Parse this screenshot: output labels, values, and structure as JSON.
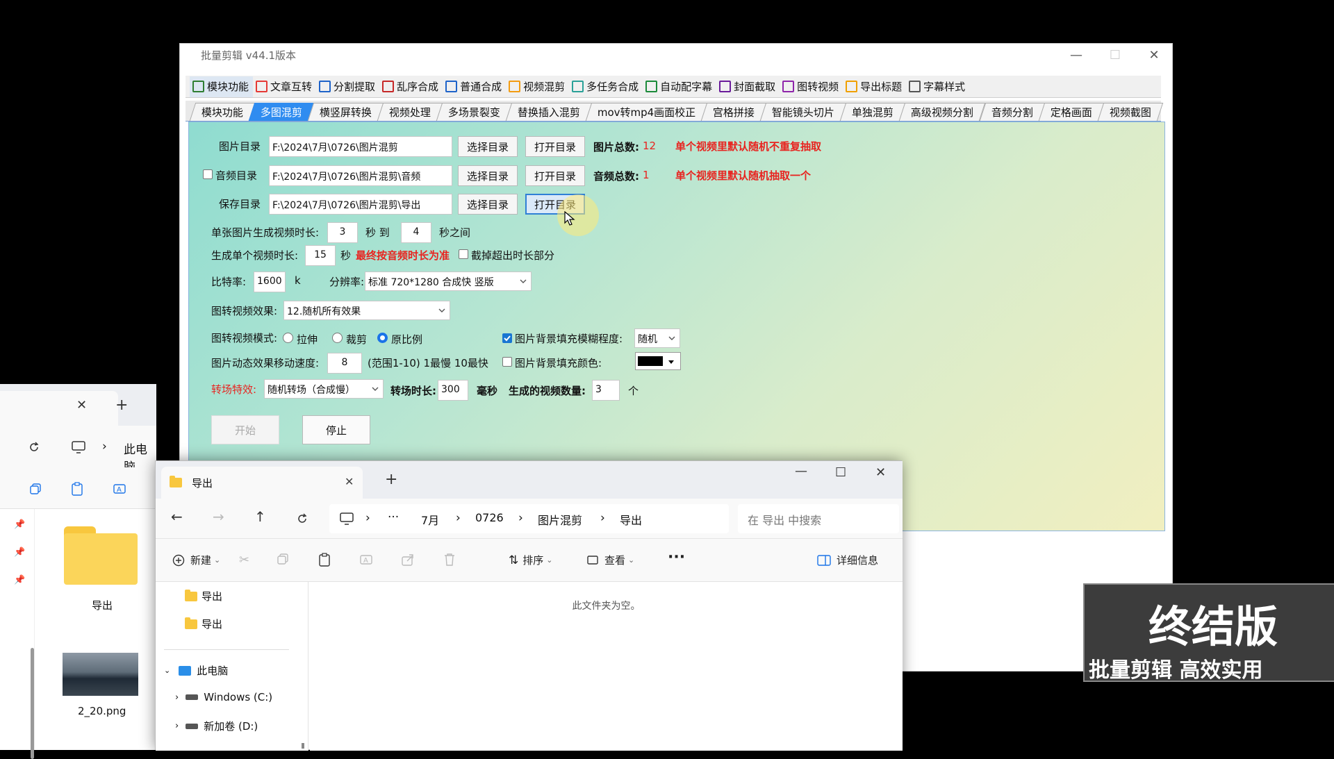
{
  "app": {
    "title": "批量剪辑   v44.1版本",
    "toolbar": [
      "模块功能",
      "文章互转",
      "分割提取",
      "乱序合成",
      "普通合成",
      "视频混剪",
      "多任务合成",
      "自动配字幕",
      "封面截取",
      "图转视频",
      "导出标题",
      "字幕样式"
    ],
    "toolbar_colors": [
      "#2e7d32",
      "#e53935",
      "#1e63c9",
      "#c62828",
      "#1e63c9",
      "#f39c12",
      "#2aa198",
      "#1b8a3a",
      "#6a1b9a",
      "#8e24aa",
      "#f0a000",
      "#555555"
    ],
    "tabs": [
      "模块功能",
      "多图混剪",
      "横竖屏转换",
      "视频处理",
      "多场景裂变",
      "替换插入混剪",
      "mov转mp4画面校正",
      "宫格拼接",
      "智能镜头切片",
      "单独混剪",
      "高级视频分割",
      "音频分割",
      "定格画面",
      "视频截图"
    ],
    "active_tab": "多图混剪",
    "form": {
      "image_dir_label": "图片目录",
      "image_dir": "F:\\2024\\7月\\0726\\图片混剪",
      "audio_dir_label": "音频目录",
      "audio_dir": "F:\\2024\\7月\\0726\\图片混剪\\音频",
      "save_dir_label": "保存目录",
      "save_dir": "F:\\2024\\7月\\0726\\图片混剪\\导出",
      "select_dir": "选择目录",
      "open_dir": "打开目录",
      "image_total_label": "图片总数:",
      "image_total": "12",
      "image_note": "单个视频里默认随机不重复抽取",
      "audio_total_label": "音频总数:",
      "audio_total": "1",
      "audio_note": "单个视频里默认随机抽取一个",
      "single_duration_label": "单张图片生成视频时长:",
      "dur_from": "3",
      "sec_to": "秒 到",
      "dur_to": "4",
      "sec_between": "秒之间",
      "video_duration_label": "生成单个视频时长:",
      "video_duration": "15",
      "sec": "秒",
      "audio_prior": "最终按音频时长为准",
      "trim_label": "截掉超出时长部分",
      "bitrate_label": "比特率:",
      "bitrate": "1600",
      "k": "k",
      "resolution_label": "分辨率:",
      "resolution": "标准 720*1280 合成快 竖版",
      "effect_label": "图转视频效果:",
      "effect": "12.随机所有效果",
      "mode_label": "图转视频模式:",
      "mode_stretch": "拉伸",
      "mode_crop": "裁剪",
      "mode_original": "原比例",
      "blur_label": "图片背景填充模糊程度:",
      "blur_value": "随机",
      "speed_label": "图片动态效果移动速度:",
      "speed": "8",
      "speed_range": "(范围1-10) 1最慢 10最快",
      "fill_color_label": "图片背景填充颜色:",
      "transition_label": "转场特效:",
      "transition": "随机转场（合成慢）",
      "transition_dur_label": "转场时长:",
      "transition_dur": "300",
      "ms": "毫秒",
      "count_label": "生成的视频数量:",
      "count": "3",
      "unit": "个",
      "start": "开始",
      "stop": "停止"
    },
    "banner": {
      "title": "终结版",
      "subtitle": "批量剪辑 高效实用"
    }
  },
  "left_explorer": {
    "breadcrumb": "此电脑",
    "folder_name": "导出",
    "file_name": "2_20.png"
  },
  "explorer": {
    "tab_title": "导出",
    "path": [
      "7月",
      "0726",
      "图片混剪",
      "导出"
    ],
    "search_placeholder": "在 导出 中搜索",
    "new": "新建",
    "sort": "排序",
    "view": "查看",
    "details": "详细信息",
    "empty": "此文件夹为空。",
    "nav_items": [
      "导出",
      "导出"
    ],
    "this_pc": "此电脑",
    "drive_c": "Windows (C:)",
    "drive_d": "新加卷 (D:)"
  }
}
